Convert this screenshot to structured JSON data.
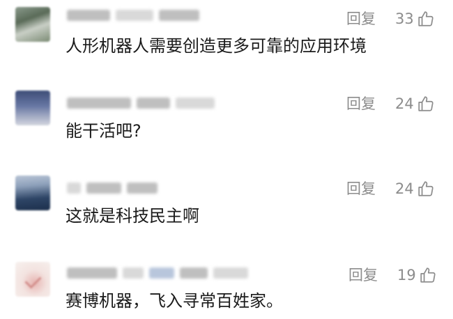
{
  "comments": [
    {
      "text": "人形机器人需要创造更多可靠的应用环境",
      "reply_label": "回复",
      "likes": "33"
    },
    {
      "text": "能干活吧?",
      "reply_label": "回复",
      "likes": "24"
    },
    {
      "text": "这就是科技民主啊",
      "reply_label": "回复",
      "likes": "24"
    },
    {
      "text": "赛博机器，飞入寻常百姓家。",
      "reply_label": "回复",
      "likes": "19"
    }
  ],
  "icons": {
    "like": "thumbs-up-icon",
    "avatar": "avatar"
  },
  "colors": {
    "meta_text": "#8c8c8c",
    "body_text": "#1b1b1b"
  }
}
